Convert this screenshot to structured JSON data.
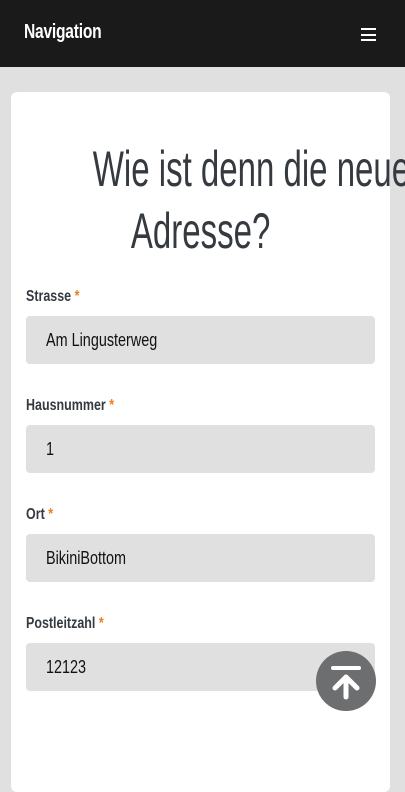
{
  "nav": {
    "brand": "Navigation",
    "menu_icon": "hamburger-icon"
  },
  "form": {
    "title_line1": "Wie ist denn die neue",
    "title_line2": "Adresse?",
    "required_marker": "*",
    "fields": [
      {
        "label": "Strasse",
        "value": "Am Lingusterweg"
      },
      {
        "label": "Hausnummer",
        "value": "1"
      },
      {
        "label": "Ort",
        "value": "BikiniBottom"
      },
      {
        "label": "Postleitzahl",
        "value": "12123"
      }
    ]
  },
  "back_to_top": {
    "icon": "arrow-up-to-line-icon"
  },
  "colors": {
    "nav_bg": "#1a1a1a",
    "required": "#f07e1b",
    "input_bg": "#e0e0e0",
    "heading": "#343a40"
  }
}
